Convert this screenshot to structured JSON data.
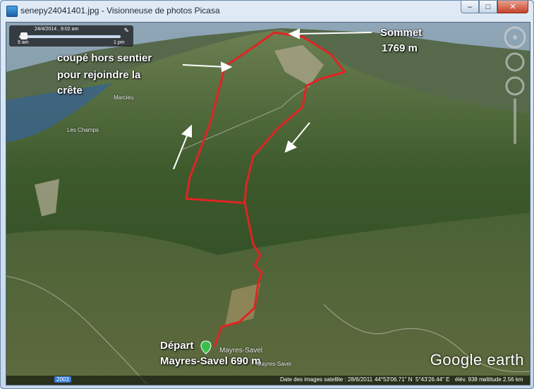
{
  "window": {
    "title": "senepy24041401.jpg - Visionneuse de photos Picasa",
    "minimize": "–",
    "maximize": "□",
    "close": "✕"
  },
  "timeslider": {
    "date": "24/4/2014 , 9:02 am",
    "start": "9 am",
    "end": "1 pm"
  },
  "annotations": {
    "summit_line1": "Sommet",
    "summit_line2": "1769 m",
    "offtrail_line1": "coupé hors sentier",
    "offtrail_line2": "pour rejoindre la",
    "offtrail_line3": "crête",
    "start_line1": "Départ",
    "start_line2": "Mayres-Savel 690 m"
  },
  "places": {
    "les_champs": "Les Champs",
    "marcieu": "Marcieu",
    "mayres_savel": "Mayres-Savel",
    "village_small": "Mayres-Savel"
  },
  "statusbar": {
    "badge": "2003",
    "imagery_date": "Date des images satellite : 28/6/2011",
    "lat": "44°53'06.71\" N",
    "lon": "5°43'26.44\" E",
    "elev": "élév. 938 m",
    "alt": "altitude 2.56 km"
  },
  "logo": {
    "brand": "Google",
    "product": "earth"
  },
  "colors": {
    "track": "#e02424",
    "frame": "#c6d8eb",
    "close": "#c4432a"
  }
}
